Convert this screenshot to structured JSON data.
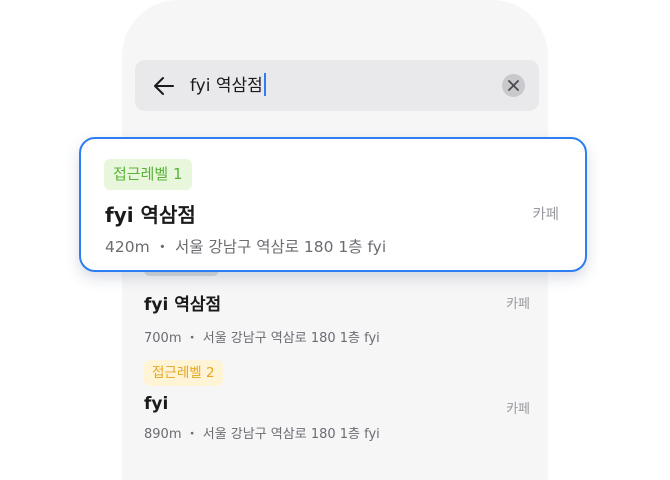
{
  "search": {
    "query": "fyi 역삼점",
    "back_icon": "arrow-left-icon",
    "clear_icon": "close-circle-icon"
  },
  "focused_result": {
    "badge": "접근레벨 1",
    "title": "fyi 역삼점",
    "category": "카페",
    "address": "420m ・ 서울 강남구 역삼로 180 1층 fyi"
  },
  "results": [
    {
      "title": "fyi 역삼점",
      "category": "카페",
      "address": "700m ・ 서울 강남구 역삼로 180 1층 fyi"
    },
    {
      "badge": "접근레벨 2",
      "title": "fyi",
      "category": "카페",
      "address": "890m ・ 서울 강남구 역삼로 180 1층 fyi"
    }
  ],
  "colors": {
    "accent": "#2d7ef3",
    "level1": "#5bb23a",
    "level2": "#e8a520"
  }
}
